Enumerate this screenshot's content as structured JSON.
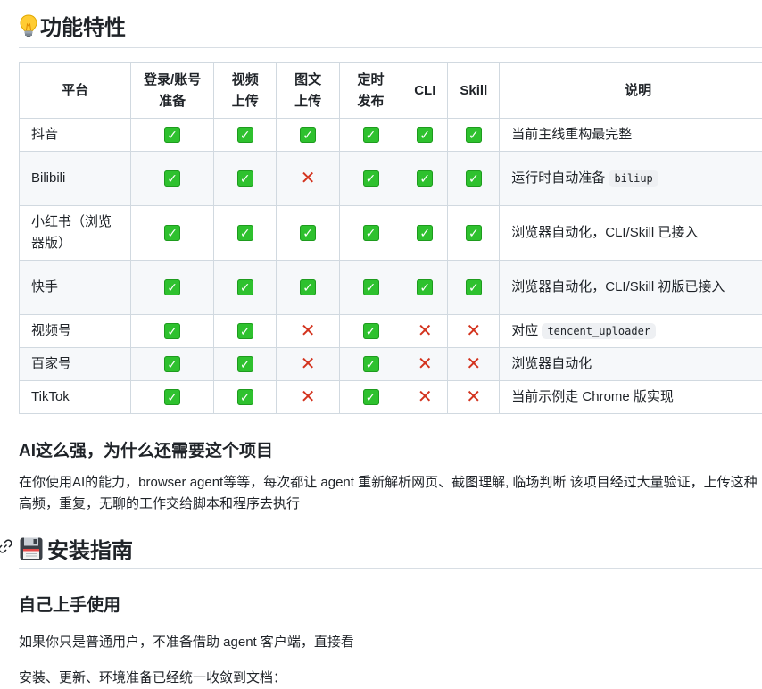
{
  "features": {
    "title": "功能特性",
    "table": {
      "headers": [
        "平台",
        "登录/账号准备",
        "视频上传",
        "图文上传",
        "定时发布",
        "CLI",
        "Skill",
        "说明"
      ],
      "rows": [
        {
          "platform": "抖音",
          "marks": [
            true,
            true,
            true,
            true,
            true,
            true
          ],
          "note": "当前主线重构最完整",
          "code": ""
        },
        {
          "platform": "Bilibili",
          "marks": [
            true,
            true,
            false,
            true,
            true,
            true
          ],
          "note": "运行时自动准备",
          "code": "biliup"
        },
        {
          "platform": "小红书（浏览器版）",
          "marks": [
            true,
            true,
            true,
            true,
            true,
            true
          ],
          "note": "浏览器自动化，CLI/Skill 已接入",
          "code": ""
        },
        {
          "platform": "快手",
          "marks": [
            true,
            true,
            true,
            true,
            true,
            true
          ],
          "note": "浏览器自动化，CLI/Skill 初版已接入",
          "code": ""
        },
        {
          "platform": "视频号",
          "marks": [
            true,
            true,
            false,
            true,
            false,
            false
          ],
          "note": "对应",
          "code": "tencent_uploader"
        },
        {
          "platform": "百家号",
          "marks": [
            true,
            true,
            false,
            true,
            false,
            false
          ],
          "note": "浏览器自动化",
          "code": ""
        },
        {
          "platform": "TikTok",
          "marks": [
            true,
            true,
            false,
            true,
            false,
            false
          ],
          "note": "当前示例走 Chrome 版实现",
          "code": ""
        }
      ]
    }
  },
  "ai_section": {
    "title": "AI这么强，为什么还需要这个项目",
    "body": "在你使用AI的能力，browser agent等等，每次都让 agent 重新解析网页、截图理解, 临场判断 该项目经过大量验证，上传这种 高频，重复，无聊的工作交给脚本和程序去执行"
  },
  "install": {
    "title": "安装指南",
    "subtitle": "自己上手使用",
    "p1": "如果你只是普通用户，不准备借助 agent 客户端，直接看",
    "p2": "安装、更新、环境准备已经统一收敛到文档："
  },
  "colors": {
    "check_bg": "#2ec12e",
    "cross": "#d3331e",
    "border": "#d1d9e0",
    "stripe": "#f6f8fa"
  }
}
